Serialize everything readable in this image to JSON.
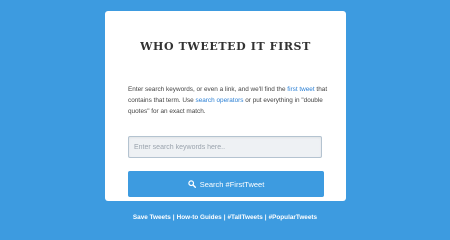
{
  "page": {
    "background_color": "#3d9be0"
  },
  "card": {
    "title": "WHO TWEETED IT FIRST",
    "description": {
      "part1": "Enter search keywords, or even a link, and we'll find the ",
      "link1": "first tweet",
      "part2": " that contains that term. Use ",
      "link2": "search operators",
      "part3": " or put everything in \"double quotes\" for an exact match."
    },
    "search": {
      "placeholder": "Enter search keywords here..",
      "value": ""
    },
    "button": {
      "label": "Search #FirstTweet",
      "icon": "search-icon",
      "color": "#3d9be0"
    }
  },
  "footer": {
    "links": [
      {
        "label": "Save Tweets"
      },
      {
        "label": "How-to Guides"
      },
      {
        "label": "#TallTweets"
      },
      {
        "label": "#PopularTweets"
      }
    ],
    "separator": "|"
  },
  "colors": {
    "link": "#2a7fd4",
    "card_background": "#ffffff"
  }
}
